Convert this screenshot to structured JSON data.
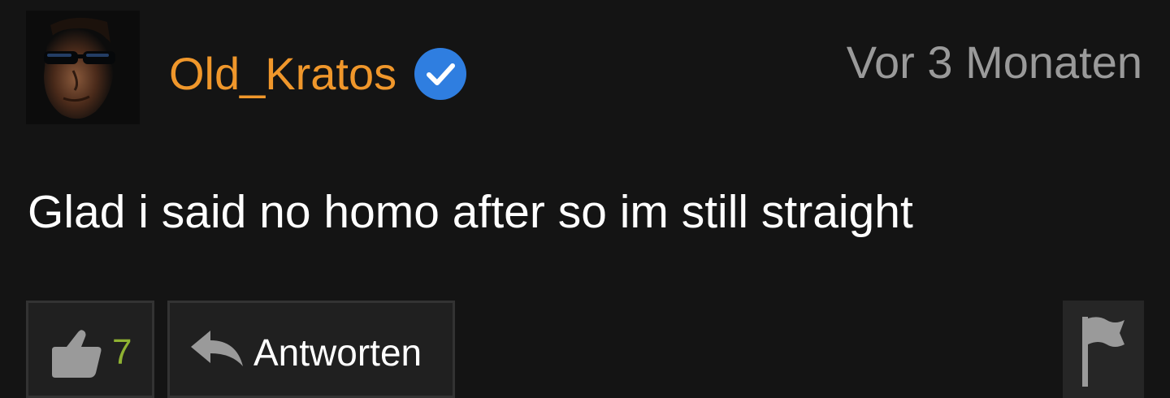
{
  "comment": {
    "author": {
      "username": "Old_Kratos",
      "verified": true,
      "avatar_icon": "user-avatar-sunglasses"
    },
    "timestamp": "Vor 3 Monaten",
    "text": "Glad i said no homo after so im still straight",
    "actions": {
      "like_icon": "thumbs-up-icon",
      "like_count": "7",
      "reply_icon": "reply-arrow-icon",
      "reply_label": "Antworten",
      "flag_icon": "flag-icon"
    }
  },
  "colors": {
    "background": "#141414",
    "username": "#f0972b",
    "verified_badge": "#2f7ee0",
    "timestamp": "#9a9a9a",
    "comment_text": "#ffffff",
    "like_count": "#8fb232",
    "button_bg": "#202020",
    "button_border": "#333333",
    "icon_grey": "#9a9a9a"
  }
}
